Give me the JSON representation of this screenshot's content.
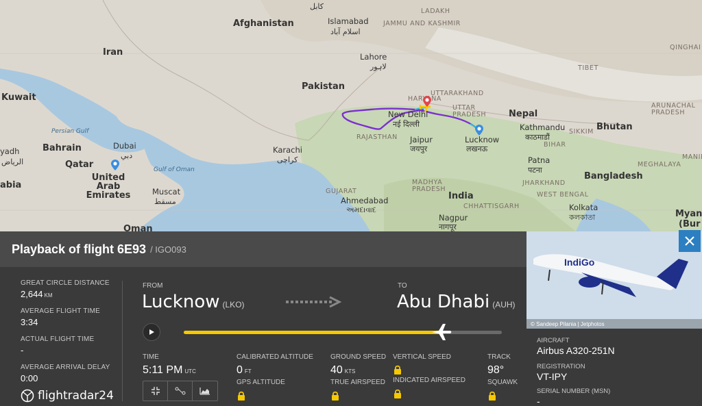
{
  "map": {
    "labels": {
      "kabul": "کابل",
      "afghanistan": "Afghanistan",
      "islamabad": "Islamabad",
      "islamabad_ur": "اسلام آباد",
      "ladakh": "LADAKH",
      "jammu_kashmir": "JAMMU AND KASHMIR",
      "iran": "Iran",
      "lahore": "Lahore",
      "lahore_ur": "لاہور",
      "tibet": "TIBET",
      "qinghai": "QINGHAI",
      "pakistan": "Pakistan",
      "haryana": "HARYANA",
      "uttarakhand": "UTTARAKHAND",
      "kuwait": "Kuwait",
      "new_delhi": "New Delhi",
      "new_delhi_hi": "नई दिल्ली",
      "uttar_pradesh": "UTTAR PRADESH",
      "nepal": "Nepal",
      "kathmandu": "Kathmandu",
      "kathmandu_ne": "काठमाडौं",
      "bhutan": "Bhutan",
      "arunachal": "ARUNACHAL PRADESH",
      "sikkim": "SIKKIM",
      "persian_gulf": "Persian Gulf",
      "rajasthan": "RAJASTHAN",
      "jaipur": "Jaipur",
      "jaipur_hi": "जयपुर",
      "lucknow": "Lucknow",
      "lucknow_hi": "लखनऊ",
      "bihar": "BIHAR",
      "bahrain": "Bahrain",
      "dubai": "Dubai",
      "dubai_ar": "دبي",
      "karachi": "Karachi",
      "karachi_ur": "کراچی",
      "riyadh": "yadh",
      "riyadh_ar": "الرياض",
      "qatar": "Qatar",
      "patna": "Patna",
      "patna_hi": "पटना",
      "meghalaya": "MEGHALAYA",
      "manipur": "MANIP",
      "gulf_oman": "Gulf of Oman",
      "uae": "United Arab Emirates",
      "bangladesh": "Bangladesh",
      "jharkhand": "JHARKHAND",
      "arabia": "abia",
      "muscat": "Muscat",
      "muscat_ar": "مسقط",
      "madhya_pradesh": "MADHYA PRADESH",
      "gujarat": "GUJARAT",
      "ahmedabad": "Ahmedabad",
      "ahmedabad_gu": "અમદાવાદ",
      "india": "India",
      "west_bengal": "WEST BENGAL",
      "kolkata": "Kolkata",
      "kolkata_bn": "কলকাতা",
      "chhattisgarh": "CHHATTISGARH",
      "nagpur": "Nagpur",
      "nagpur_hi": "नागपूर",
      "myanmar": "Myann",
      "myanmar2": "(Bur",
      "oman": "Oman"
    }
  },
  "panel": {
    "title": "Playback of flight 6E93",
    "callsign": "/ IGO093",
    "stats": {
      "gcd_label": "GREAT CIRCLE DISTANCE",
      "gcd_value": "2,644",
      "gcd_unit": "KM",
      "avg_time_label": "AVERAGE FLIGHT TIME",
      "avg_time_value": "3:34",
      "actual_time_label": "ACTUAL FLIGHT TIME",
      "actual_time_value": "-",
      "avg_delay_label": "AVERAGE ARRIVAL DELAY",
      "avg_delay_value": "0:00"
    },
    "route": {
      "from_label": "FROM",
      "from_city": "Lucknow",
      "from_code": "(LKO)",
      "to_label": "TO",
      "to_city": "Abu Dhabi",
      "to_code": "(AUH)"
    },
    "playback": {
      "progress": 0.81
    },
    "flight": {
      "time_label": "TIME",
      "time_value": "5:11 PM",
      "time_unit": "UTC",
      "cal_alt_label": "CALIBRATED ALTITUDE",
      "cal_alt_value": "0",
      "cal_alt_unit": "FT",
      "gps_alt_label": "GPS ALTITUDE",
      "ground_speed_label": "GROUND SPEED",
      "ground_speed_value": "40",
      "ground_speed_unit": "KTS",
      "true_airspeed_label": "TRUE AIRSPEED",
      "vertical_speed_label": "VERTICAL SPEED",
      "indicated_airspeed_label": "INDICATED AIRSPEED",
      "track_label": "TRACK",
      "track_value": "98°",
      "squawk_label": "SQUAWK"
    },
    "logo_text": "flightradar24"
  },
  "side": {
    "photo_credit": "© Sandeep Pilania | Jetphotos",
    "aircraft_label": "AIRCRAFT",
    "aircraft_value": "Airbus A320-251N",
    "registration_label": "REGISTRATION",
    "registration_value": "VT-IPY",
    "serial_label": "SERIAL NUMBER (MSN)",
    "serial_value": "-",
    "airline_livery_text": "IndiGo"
  },
  "colors": {
    "track_purple": "#7b2fd0",
    "progress_yellow": "#f6c800",
    "close_blue": "#2c7fc1",
    "pin_blue": "#3a8de0",
    "pin_red": "#e0474c"
  }
}
